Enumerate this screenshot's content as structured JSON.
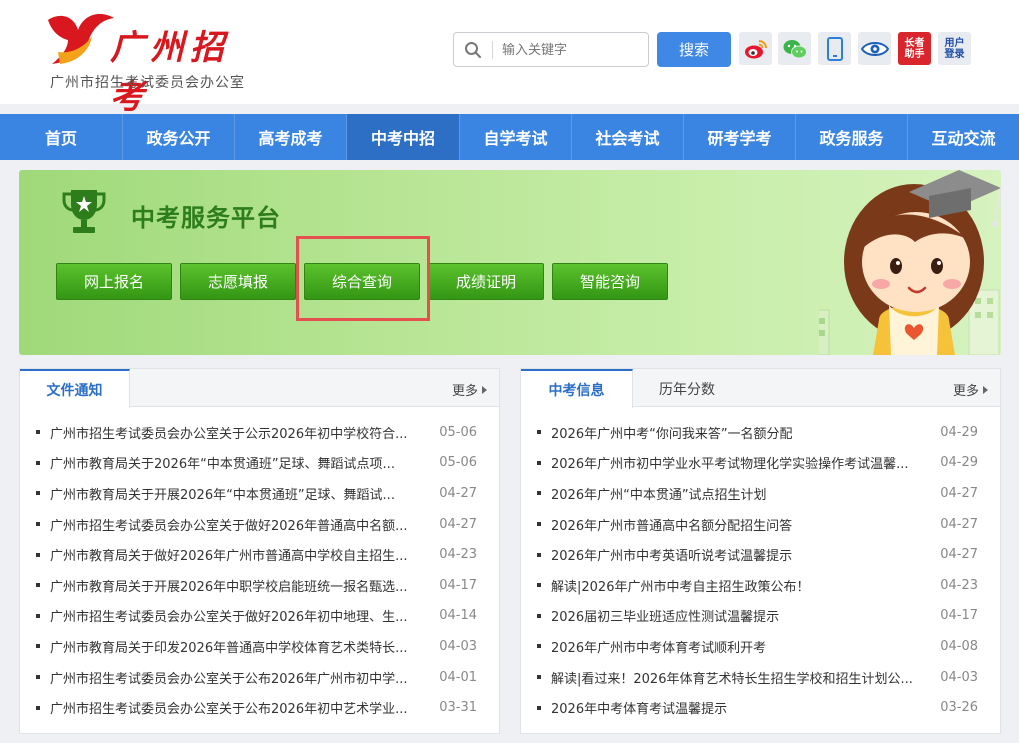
{
  "header": {
    "logo_script": "广州招考",
    "logo_subtitle": "广州市招生考试委员会办公室",
    "search_placeholder": "输入关键字",
    "search_button": "搜索",
    "tools": [
      {
        "icon": "weibo-icon",
        "label": ""
      },
      {
        "icon": "wechat-icon",
        "label": ""
      },
      {
        "icon": "mobile-icon",
        "label": ""
      },
      {
        "icon": "eye-icon",
        "label": ""
      },
      {
        "icon": "elder-assistant-icon",
        "label": "长者助手"
      },
      {
        "icon": "user-login-icon",
        "label": "用户登录"
      }
    ],
    "tool_text": {
      "elder_line1": "长者",
      "elder_line2": "助手",
      "login_line1": "用户",
      "login_line2": "登录"
    }
  },
  "nav": {
    "items": [
      "首页",
      "政务公开",
      "高考成考",
      "中考中招",
      "自学考试",
      "社会考试",
      "研考学考",
      "政务服务",
      "互动交流"
    ],
    "active_index": 3
  },
  "banner": {
    "title": "中考服务平台",
    "buttons": [
      "网上报名",
      "志愿填报",
      "综合查询",
      "成绩证明",
      "智能咨询"
    ],
    "highlighted": "综合查询"
  },
  "panel_left": {
    "tabs": [
      "文件通知"
    ],
    "more": "更多",
    "items": [
      {
        "title": "广州市招生考试委员会办公室关于公示2026年初中学校符合...",
        "date": "05-06"
      },
      {
        "title": "广州市教育局关于2026年“中本贯通班”足球、舞蹈试点项...",
        "date": "05-06"
      },
      {
        "title": "广州市教育局关于开展2026年“中本贯通班”足球、舞蹈试...",
        "date": "04-27"
      },
      {
        "title": "广州市招生考试委员会办公室关于做好2026年普通高中名额...",
        "date": "04-27"
      },
      {
        "title": "广州市教育局关于做好2026年广州市普通高中学校自主招生...",
        "date": "04-23"
      },
      {
        "title": "广州市教育局关于开展2026年中职学校启能班统一报名甄选...",
        "date": "04-17"
      },
      {
        "title": "广州市招生考试委员会办公室关于做好2026年初中地理、生...",
        "date": "04-14"
      },
      {
        "title": "广州市教育局关于印发2026年普通高中学校体育艺术类特长...",
        "date": "04-03"
      },
      {
        "title": "广州市招生考试委员会办公室关于公布2026年广州市初中学...",
        "date": "04-01"
      },
      {
        "title": "广州市招生考试委员会办公室关于公布2026年初中艺术学业...",
        "date": "03-31"
      }
    ]
  },
  "panel_right": {
    "tabs": [
      "中考信息",
      "历年分数"
    ],
    "more": "更多",
    "items": [
      {
        "title": "2026年广州中考“你问我来答”一名额分配",
        "date": "04-29"
      },
      {
        "title": "2026年广州市初中学业水平考试物理化学实验操作考试温馨...",
        "date": "04-29"
      },
      {
        "title": "2026年广州“中本贯通”试点招生计划",
        "date": "04-27"
      },
      {
        "title": "2026年广州市普通高中名额分配招生问答",
        "date": "04-27"
      },
      {
        "title": "2026年广州市中考英语听说考试温馨提示",
        "date": "04-27"
      },
      {
        "title": "解读|2026年广州市中考自主招生政策公布！",
        "date": "04-23"
      },
      {
        "title": "2026届初三毕业班适应性测试温馨提示",
        "date": "04-17"
      },
      {
        "title": "2026年广州市中考体育考试顺利开考",
        "date": "04-08"
      },
      {
        "title": "解读|看过来！2026年体育艺术特长生招生学校和招生计划公...",
        "date": "04-03"
      },
      {
        "title": "2026年中考体育考试温馨提示",
        "date": "03-26"
      }
    ]
  },
  "colors": {
    "brand_red": "#d8171e",
    "nav_blue": "#3a85e2",
    "nav_active": "#2d6fc4",
    "banner_green": "#9fd97a",
    "button_green": "#339615",
    "highlight_red": "#e45050",
    "tab_blue": "#2c6fc7"
  }
}
